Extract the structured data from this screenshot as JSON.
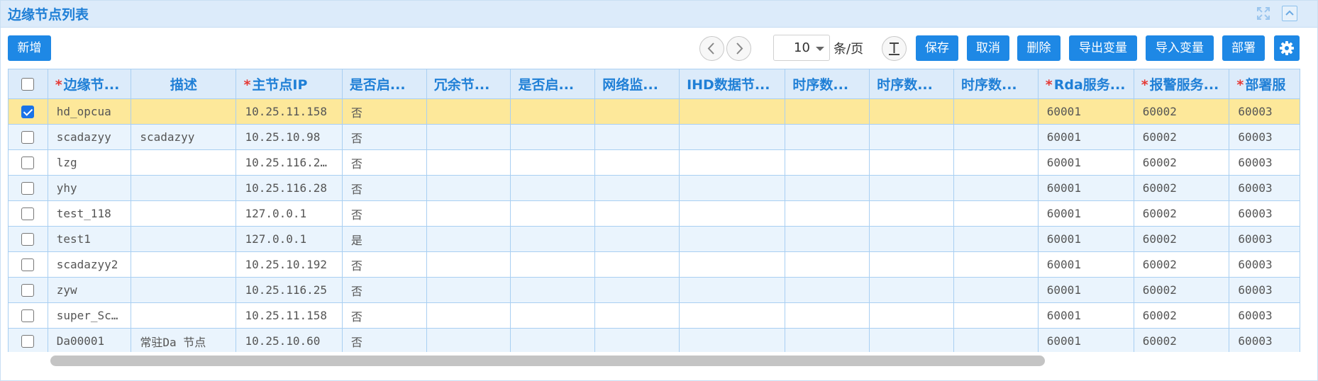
{
  "title": "边缘节点列表",
  "toolbar": {
    "add_label": "新增",
    "page_size": "10",
    "page_unit": "条/页",
    "save_label": "保存",
    "cancel_label": "取消",
    "delete_label": "删除",
    "export_label": "导出变量",
    "import_label": "导入变量",
    "deploy_label": "部署"
  },
  "columns": [
    {
      "label": "边缘节...",
      "required": true
    },
    {
      "label": "描述",
      "required": false
    },
    {
      "label": "主节点IP",
      "required": true
    },
    {
      "label": "是否启...",
      "required": false
    },
    {
      "label": "冗余节...",
      "required": false
    },
    {
      "label": "是否启...",
      "required": false
    },
    {
      "label": "网络监...",
      "required": false
    },
    {
      "label": "IHD数据节...",
      "required": false
    },
    {
      "label": "时序数...",
      "required": false
    },
    {
      "label": "时序数...",
      "required": false
    },
    {
      "label": "时序数...",
      "required": false
    },
    {
      "label": "Rda服务...",
      "required": true
    },
    {
      "label": "报警服务...",
      "required": true
    },
    {
      "label": "部署服",
      "required": true
    }
  ],
  "rows": [
    {
      "checked": true,
      "cells": [
        "hd_opcua",
        "",
        "10.25.11.158",
        "否",
        "",
        "",
        "",
        "",
        "",
        "",
        "",
        "60001",
        "60002",
        "60003"
      ]
    },
    {
      "checked": false,
      "cells": [
        "scadazyy",
        "scadazyy",
        "10.25.10.98",
        "否",
        "",
        "",
        "",
        "",
        "",
        "",
        "",
        "60001",
        "60002",
        "60003"
      ]
    },
    {
      "checked": false,
      "cells": [
        "lzg",
        "",
        "10.25.116.2…",
        "否",
        "",
        "",
        "",
        "",
        "",
        "",
        "",
        "60001",
        "60002",
        "60003"
      ]
    },
    {
      "checked": false,
      "cells": [
        "yhy",
        "",
        "10.25.116.28",
        "否",
        "",
        "",
        "",
        "",
        "",
        "",
        "",
        "60001",
        "60002",
        "60003"
      ]
    },
    {
      "checked": false,
      "cells": [
        "test_118",
        "",
        "127.0.0.1",
        "否",
        "",
        "",
        "",
        "",
        "",
        "",
        "",
        "60001",
        "60002",
        "60003"
      ]
    },
    {
      "checked": false,
      "cells": [
        "test1",
        "",
        "127.0.0.1",
        "是",
        "",
        "",
        "",
        "",
        "",
        "",
        "",
        "60001",
        "60002",
        "60003"
      ]
    },
    {
      "checked": false,
      "cells": [
        "scadazyy2",
        "",
        "10.25.10.192",
        "否",
        "",
        "",
        "",
        "",
        "",
        "",
        "",
        "60001",
        "60002",
        "60003"
      ]
    },
    {
      "checked": false,
      "cells": [
        "zyw",
        "",
        "10.25.116.25",
        "否",
        "",
        "",
        "",
        "",
        "",
        "",
        "",
        "60001",
        "60002",
        "60003"
      ]
    },
    {
      "checked": false,
      "cells": [
        "super_Sc…",
        "",
        "10.25.11.158",
        "否",
        "",
        "",
        "",
        "",
        "",
        "",
        "",
        "60001",
        "60002",
        "60003"
      ]
    },
    {
      "checked": false,
      "cells": [
        "Da00001",
        "常驻Da 节点",
        "10.25.10.60",
        "否",
        "",
        "",
        "",
        "",
        "",
        "",
        "",
        "60001",
        "60002",
        "60003"
      ]
    }
  ],
  "colors": {
    "accent": "#1e88e5",
    "header_bg": "#dcebfa",
    "row_selected": "#fde89a",
    "row_alt": "#eaf4fd",
    "required": "#e53935"
  }
}
